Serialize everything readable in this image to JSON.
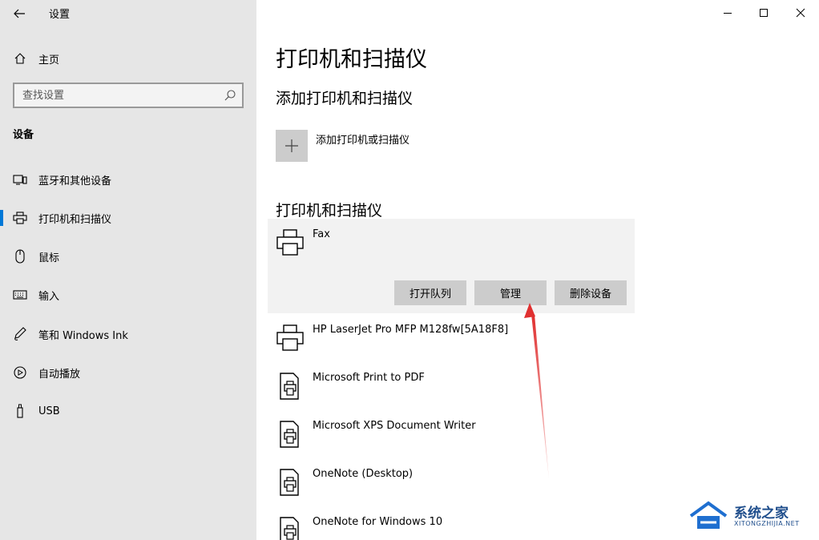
{
  "theme": {
    "accent": "#0078d7",
    "sidebar_bg": "#e6e6e6",
    "annotation_red": "#e03030"
  },
  "titlebar": {
    "app_title": "设置",
    "back_icon": "arrow-left-icon",
    "minimize_icon": "minimize-icon",
    "maximize_icon": "maximize-icon",
    "close_icon": "close-icon"
  },
  "sidebar": {
    "home": {
      "label": "主页",
      "icon": "home-icon"
    },
    "search": {
      "placeholder": "查找设置",
      "value": ""
    },
    "section_heading": "设备",
    "items": [
      {
        "label": "蓝牙和其他设备",
        "icon": "bluetooth-device-icon",
        "selected": false
      },
      {
        "label": "打印机和扫描仪",
        "icon": "printer-icon",
        "selected": true
      },
      {
        "label": "鼠标",
        "icon": "mouse-icon",
        "selected": false
      },
      {
        "label": "输入",
        "icon": "keyboard-icon",
        "selected": false
      },
      {
        "label": "笔和 Windows Ink",
        "icon": "pen-icon",
        "selected": false
      },
      {
        "label": "自动播放",
        "icon": "autoplay-icon",
        "selected": false
      },
      {
        "label": "USB",
        "icon": "usb-icon",
        "selected": false
      }
    ]
  },
  "main": {
    "page_title": "打印机和扫描仪",
    "add_section": {
      "heading": "添加打印机和扫描仪",
      "add_label": "添加打印机或扫描仪"
    },
    "list_section": {
      "heading": "打印机和扫描仪",
      "printers": [
        {
          "name": "Fax",
          "icon": "printer-icon",
          "expanded": true,
          "actions": {
            "open_queue": "打开队列",
            "manage": "管理",
            "remove": "删除设备"
          }
        },
        {
          "name": "HP LaserJet Pro MFP M128fw[5A18F8]",
          "icon": "printer-icon",
          "expanded": false
        },
        {
          "name": "Microsoft Print to PDF",
          "icon": "document-printer-icon",
          "expanded": false
        },
        {
          "name": "Microsoft XPS Document Writer",
          "icon": "document-printer-icon",
          "expanded": false
        },
        {
          "name": "OneNote (Desktop)",
          "icon": "document-printer-icon",
          "expanded": false
        },
        {
          "name": "OneNote for Windows 10",
          "icon": "document-printer-icon",
          "expanded": false
        }
      ]
    }
  },
  "watermark": {
    "text": "系统之家",
    "subtext": "XITONGZHIJIA.NET"
  }
}
